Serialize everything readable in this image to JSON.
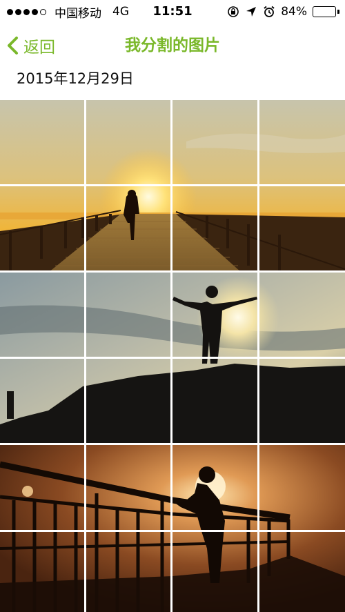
{
  "status_bar": {
    "carrier": "中国移动",
    "network": "4G",
    "time": "11:51",
    "battery": "84%",
    "battery_level": 0.84,
    "signal_bars_filled": 4,
    "signal_bars_total": 5,
    "icons": [
      "rotation-lock-icon",
      "location-arrow-icon",
      "alarm-icon",
      "battery-icon"
    ]
  },
  "nav": {
    "back_label": "返回",
    "title": "我分割的图片",
    "accent_color": "#7ab82a"
  },
  "date_label": "2015年12月29日",
  "photo_grid": {
    "columns": 4,
    "rows_visible": 6,
    "photos": [
      {
        "scene": "runner-on-boardwalk-at-sunset"
      },
      {
        "scene": "person-arms-outstretched-on-hill-silhouette"
      },
      {
        "scene": "person-leaning-on-railing-silhouette"
      }
    ]
  }
}
